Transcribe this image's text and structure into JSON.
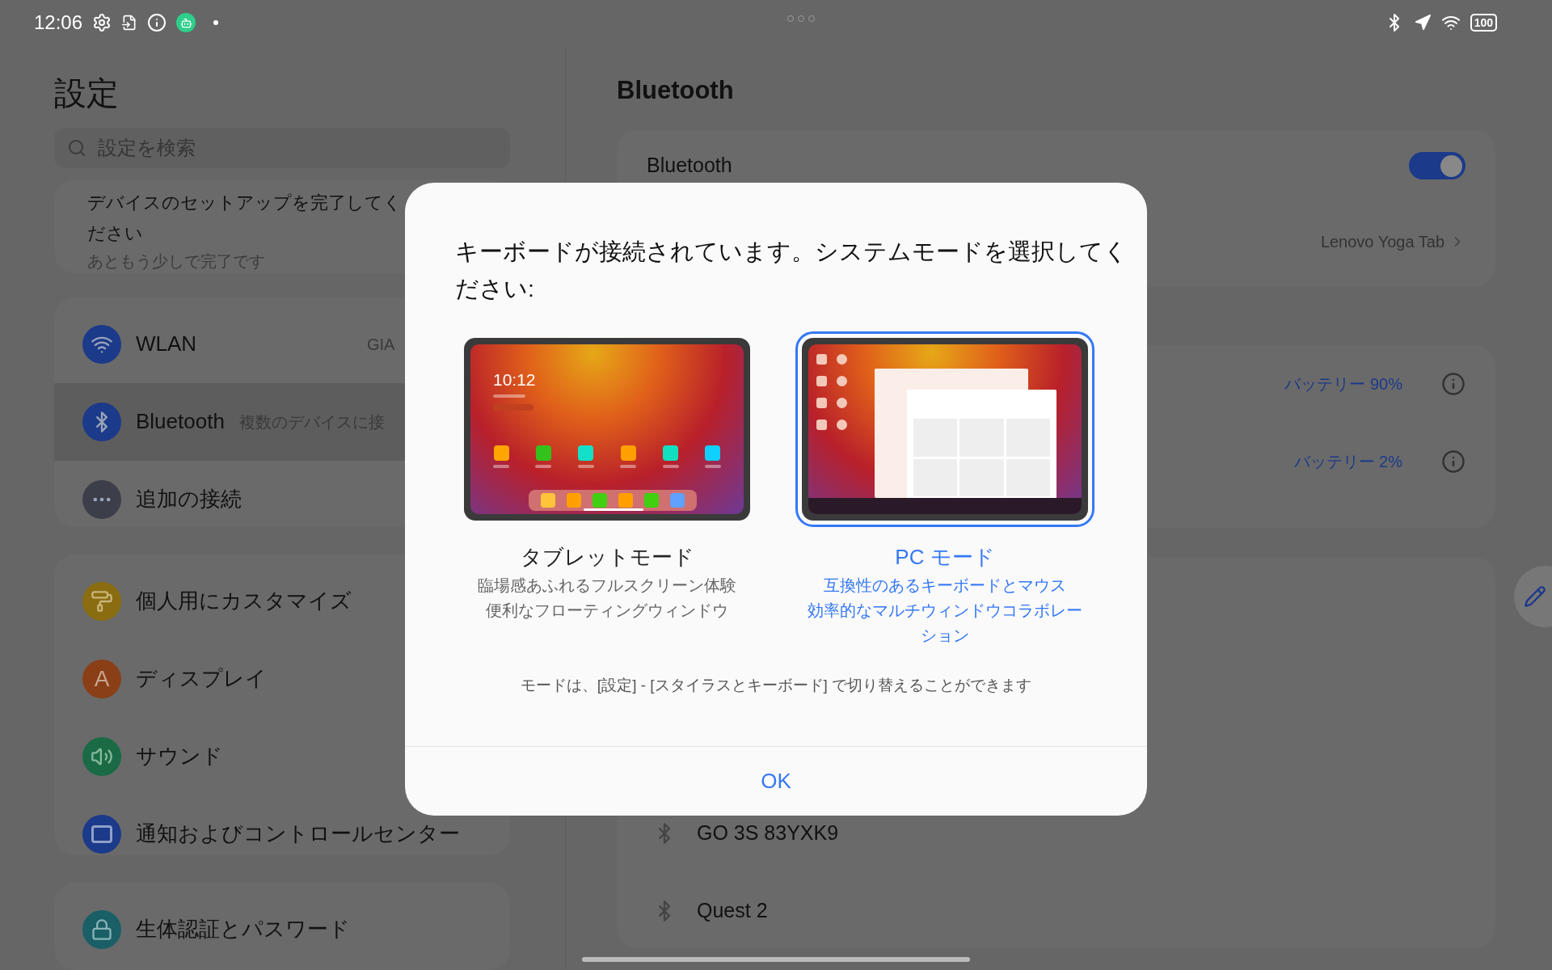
{
  "status_bar": {
    "time": "12:06",
    "battery": "100"
  },
  "sidebar": {
    "title": "設定",
    "search": {
      "placeholder": "設定を検索"
    },
    "setup_card": {
      "title": "デバイスのセットアップを完了してください",
      "subtitle": "あともう少しで完了です"
    },
    "groups": [
      {
        "items": [
          {
            "label": "WLAN",
            "value": "GIA",
            "color": "#1c3a8a",
            "selected": false
          },
          {
            "label": "Bluetooth",
            "value": "複数のデバイスに接",
            "color": "#1c3a8a",
            "selected": true
          },
          {
            "label": "追加の接続",
            "color": "#3c3f4a",
            "selected": false
          }
        ]
      },
      {
        "items": [
          {
            "label": "個人用にカスタマイズ",
            "color": "#8a6d10",
            "selected": false
          },
          {
            "label": "ディスプレイ",
            "icon_letter": "A",
            "color": "#8a3f16",
            "selected": false
          },
          {
            "label": "サウンド",
            "color": "#1a6b45",
            "selected": false
          },
          {
            "label": "通知およびコントロールセンター",
            "color": "#1c3a8a",
            "selected": false
          }
        ]
      },
      {
        "items": [
          {
            "label": "生体認証とパスワード",
            "color": "#1a5f66",
            "selected": false
          }
        ]
      }
    ]
  },
  "content": {
    "title": "Bluetooth",
    "bluetooth_toggle": {
      "label": "Bluetooth",
      "on": true
    },
    "paired_device": {
      "value": "Lenovo Yoga Tab"
    },
    "devices": [
      {
        "battery": "バッテリー 90%"
      },
      {
        "battery": "バッテリー 2%"
      }
    ],
    "available_devices": [
      {
        "name": "GO 3S 83YXK9"
      },
      {
        "name": "Quest 2"
      }
    ]
  },
  "dialog": {
    "message": "キーボードが接続されています。システムモードを選択してください:",
    "modes": [
      {
        "kind": "tablet",
        "title": "タブレットモード",
        "lines": [
          "臨場感あふれるフルスクリーン体験",
          "便利なフローティングウィンドウ"
        ],
        "clock": "10:12",
        "selected": false
      },
      {
        "kind": "pc",
        "title": "PC モード",
        "lines": [
          "互換性のあるキーボードとマウス",
          "効率的なマルチウィンドウコラボレーション"
        ],
        "selected": true
      }
    ],
    "note": "モードは、[設定] - [スタイラスとキーボード] で切り替えることができます",
    "button": "OK"
  }
}
